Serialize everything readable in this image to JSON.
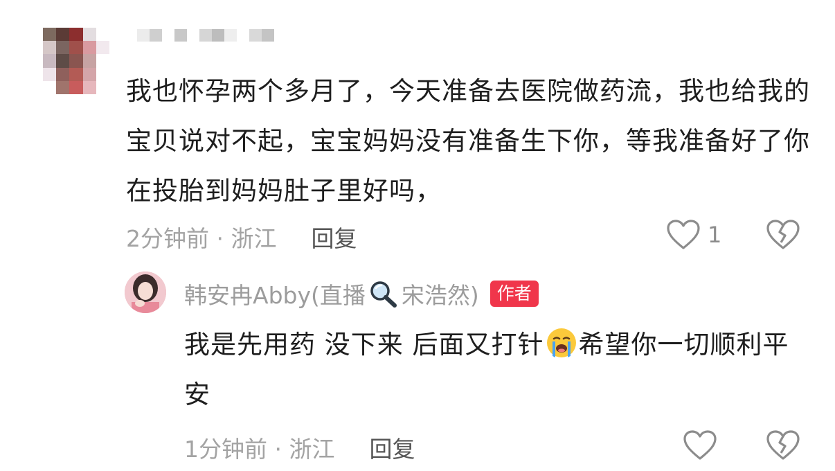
{
  "comment": {
    "text": "我也怀孕两个多月了，今天准备去医院做药流，我也给我的宝贝说对不起，宝宝妈妈没有准备生下你，等我准备好了你在投胎到妈妈肚子里好吗，",
    "time_location": "2分钟前 · 浙江",
    "reply_label": "回复",
    "like_count": "1"
  },
  "reply": {
    "author_name_prefix": "韩安冉Abby(直播",
    "author_name_suffix": "宋浩然)",
    "author_badge": "作者",
    "text_part1": "我是先用药 没下来 后面又打针",
    "text_part2": "希望你一切顺利平安",
    "time_location": "1分钟前 · 浙江",
    "reply_label": "回复"
  },
  "icons": {
    "like": "heart-outline-icon",
    "dislike": "broken-heart-icon",
    "search": "magnifier-icon",
    "crying": "crying-face-emoji"
  },
  "colors": {
    "badge": "#f0364b",
    "meta_text": "#a3a3a3",
    "reply_link": "#555555"
  }
}
